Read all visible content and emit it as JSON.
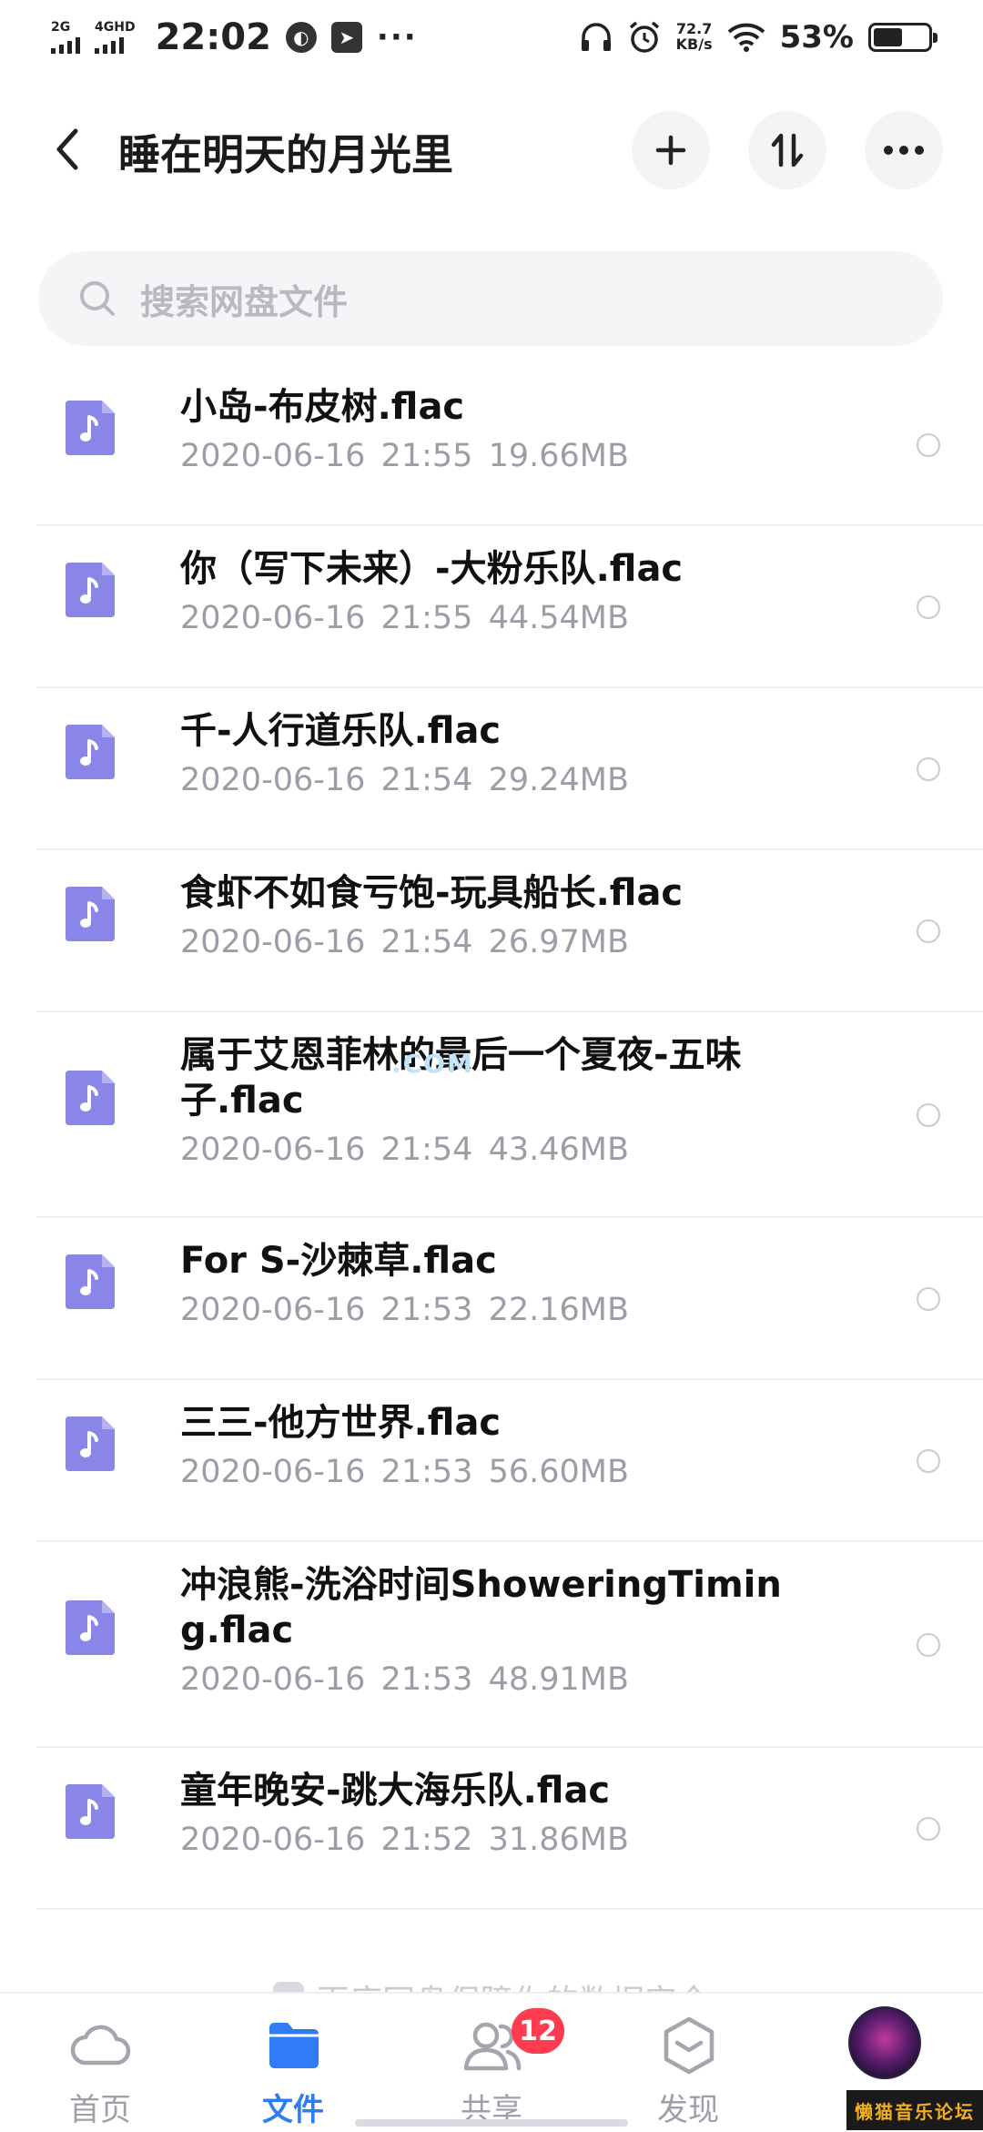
{
  "status_bar": {
    "net1_label": "2G",
    "net2_label": "4GHD",
    "time": "22:02",
    "more": "···",
    "speed_value": "72.7",
    "speed_unit": "KB/s",
    "battery_percent": "53%",
    "battery_level": 0.53
  },
  "header": {
    "title": "睡在明天的月光里",
    "back_icon": "chevron-left-icon",
    "add_icon": "plus-icon",
    "sort_icon": "sort-icon",
    "more_icon": "more-icon"
  },
  "search": {
    "placeholder": "搜索网盘文件"
  },
  "files": [
    {
      "name": "小岛-布皮树.flac",
      "date": "2020-06-16",
      "time": "21:55",
      "size": "19.66MB"
    },
    {
      "name": "你（写下未来）-大粉乐队.flac",
      "date": "2020-06-16",
      "time": "21:55",
      "size": "44.54MB"
    },
    {
      "name": "千-人行道乐队.flac",
      "date": "2020-06-16",
      "time": "21:54",
      "size": "29.24MB"
    },
    {
      "name": "食虾不如食亏饱-玩具船长.flac",
      "date": "2020-06-16",
      "time": "21:54",
      "size": "26.97MB"
    },
    {
      "name": "属于艾恩菲林的最后一个夏夜-五味子.flac",
      "date": "2020-06-16",
      "time": "21:54",
      "size": "43.46MB"
    },
    {
      "name": "For  S-沙棘草.flac",
      "date": "2020-06-16",
      "time": "21:53",
      "size": "22.16MB"
    },
    {
      "name": "三三-他方世界.flac",
      "date": "2020-06-16",
      "time": "21:53",
      "size": "56.60MB"
    },
    {
      "name": "冲浪熊-洗浴时间ShoweringTiming.flac",
      "date": "2020-06-16",
      "time": "21:53",
      "size": "48.91MB"
    },
    {
      "name": "童年晚安-跳大海乐队.flac",
      "date": "2020-06-16",
      "time": "21:52",
      "size": "31.86MB"
    }
  ],
  "security_note": "百度网盘保障你的数据安全",
  "bottom_nav": {
    "items": [
      {
        "label": "首页",
        "icon": "cloud-icon"
      },
      {
        "label": "文件",
        "icon": "folder-icon"
      },
      {
        "label": "共享",
        "icon": "people-icon",
        "badge": "12"
      },
      {
        "label": "发现",
        "icon": "cube-icon"
      }
    ]
  },
  "forum_tag": "懒猫音乐论坛",
  "colors": {
    "accent": "#2f7cf6",
    "file_icon": "#8a86e8",
    "badge": "#ff3b4f",
    "meta_text": "#9b9ea6"
  }
}
